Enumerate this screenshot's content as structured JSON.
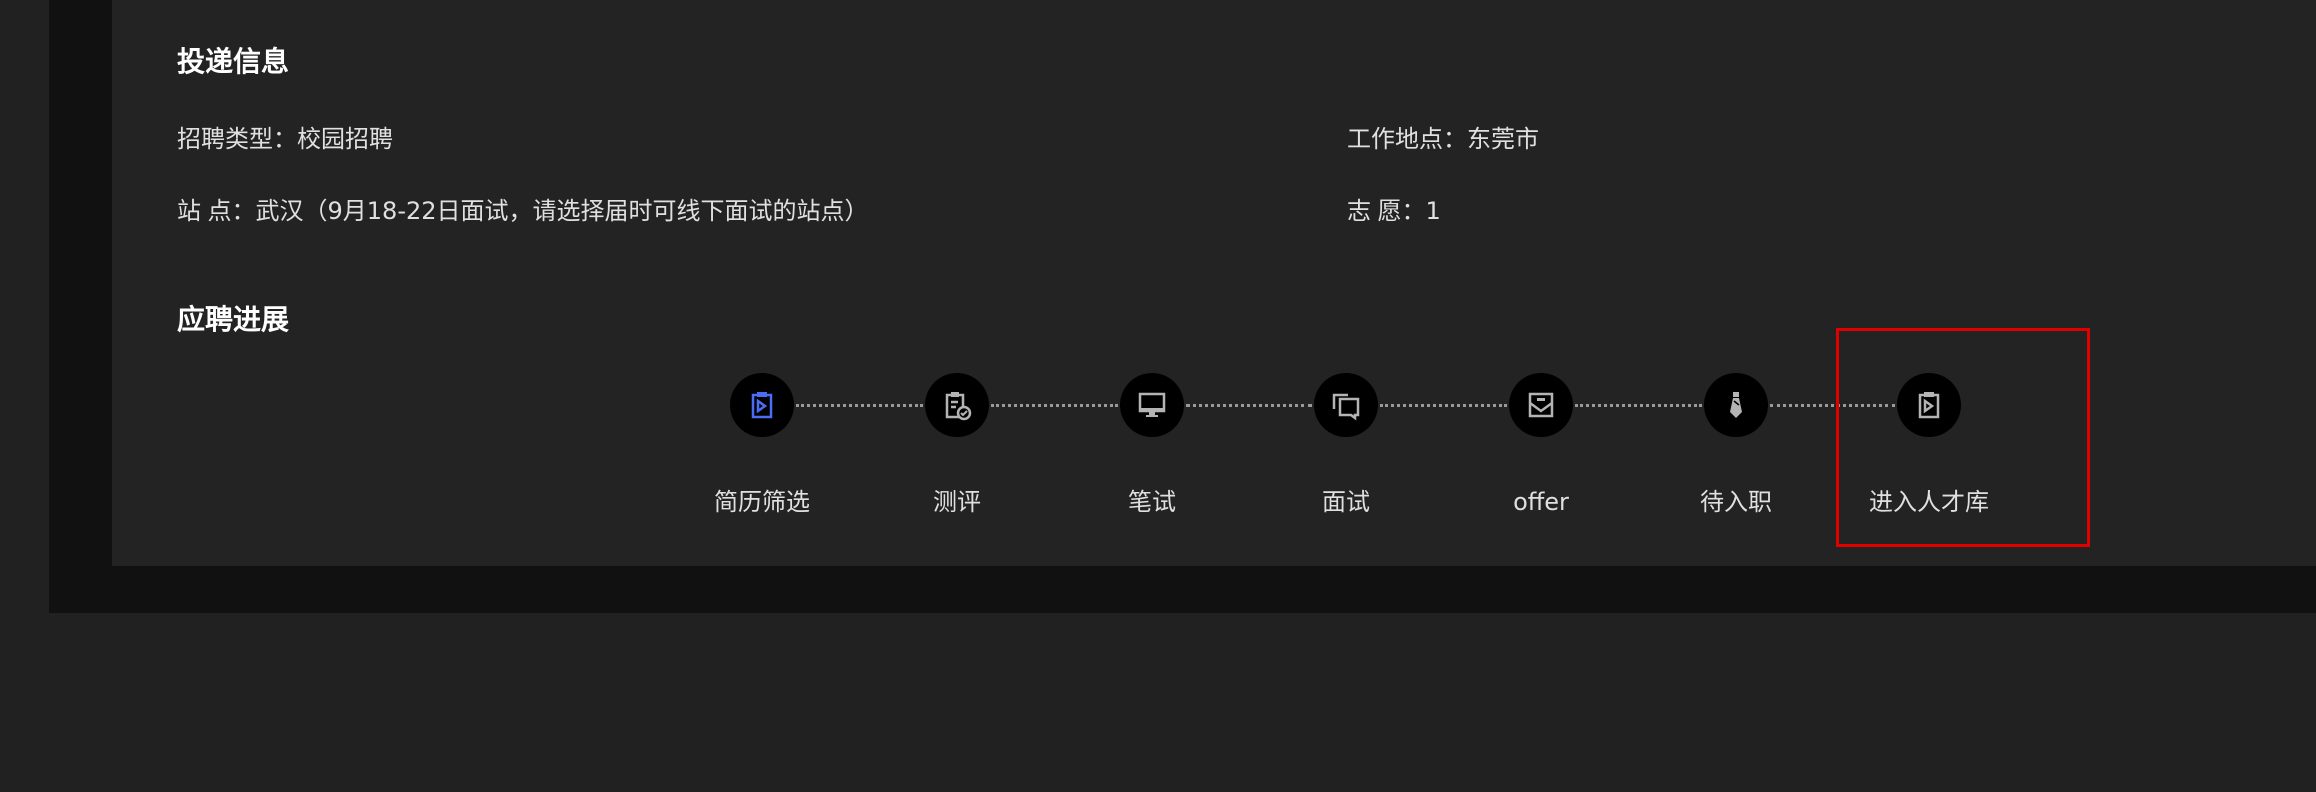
{
  "delivery_info": {
    "title": "投递信息",
    "recruit_type_label": "招聘类型：",
    "recruit_type_value": "校园招聘",
    "work_location_label": "工作地点：",
    "work_location_value": "东莞市",
    "site_label": "站\t点：",
    "site_value": "武汉（9月18-22日面试，请选择届时可线下面试的站点）",
    "preference_label": "志\t愿：",
    "preference_value": "1"
  },
  "progress": {
    "title": "应聘进展",
    "accent_color": "#4a6cf7",
    "icon_color": "#b4b4b4",
    "steps": [
      {
        "label": "简历筛选",
        "icon": "clipboard-arrow-icon",
        "active": true
      },
      {
        "label": "测评",
        "icon": "clipboard-check-icon",
        "active": false
      },
      {
        "label": "笔试",
        "icon": "monitor-icon",
        "active": false
      },
      {
        "label": "面试",
        "icon": "chat-bubbles-icon",
        "active": false
      },
      {
        "label": "offer",
        "icon": "envelope-icon",
        "active": false
      },
      {
        "label": "待入职",
        "icon": "necktie-icon",
        "active": false
      },
      {
        "label": "进入人才库",
        "icon": "clipboard-arrow-icon",
        "active": false
      }
    ]
  }
}
